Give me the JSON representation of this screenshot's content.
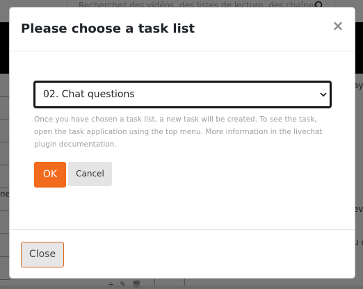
{
  "background": {
    "search_placeholder": "Recherchez des vidéos, des listes de lecture, des chaînes",
    "right_fragments": [
      "ay",
      "ev",
      "u c"
    ],
    "left_fragment": "nex"
  },
  "modal": {
    "title": "Please choose a task list",
    "close_symbol": "×",
    "select": {
      "selected_value": "02. Chat questions"
    },
    "help_text": "Once you have chosen a task list, a new task will be created. To see the task, open the task application using the top menu. More information in the livechat plugin documentation.",
    "ok_label": "OK",
    "cancel_label": "Cancel",
    "footer_close_label": "Close"
  },
  "colors": {
    "accent": "#f26a1b",
    "overlay": "rgba(0,0,0,0.5)"
  },
  "icons": {
    "search": "search-icon",
    "chevron": "chevron-down-icon",
    "close": "close-icon"
  }
}
